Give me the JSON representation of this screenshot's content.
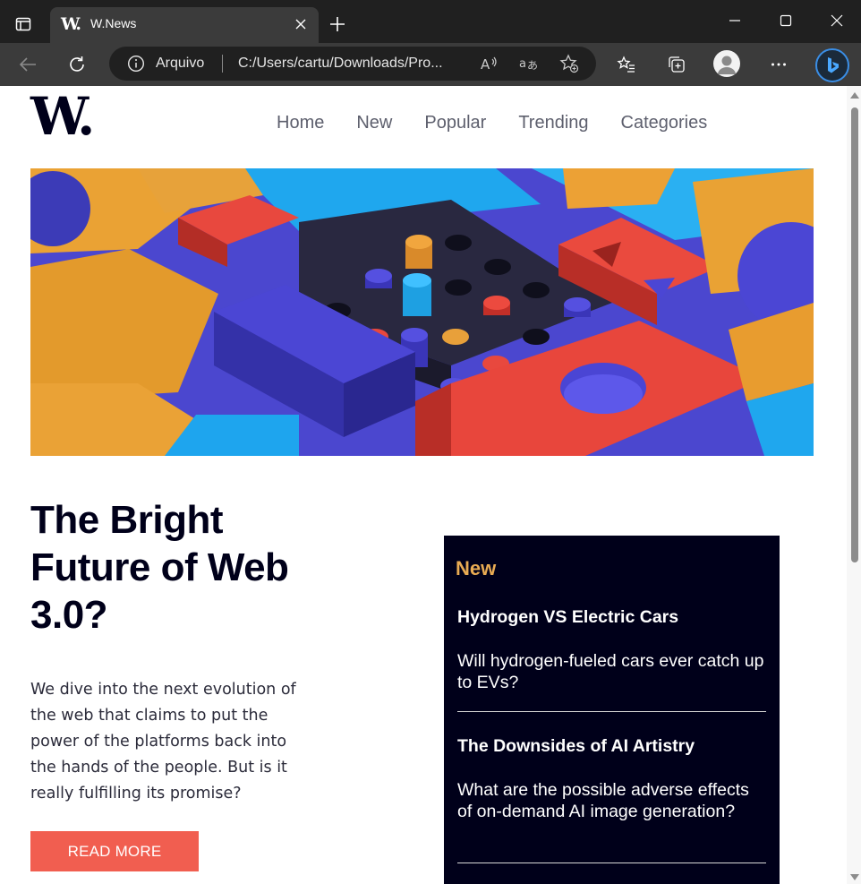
{
  "browser": {
    "tab_title": "W.News",
    "tab_favicon": "W.",
    "address_label": "Arquivo",
    "address_url": "C:/Users/cartu/Downloads/Pro...",
    "icons": [
      "tab-actions-icon",
      "close-icon",
      "plus-icon",
      "minimize-icon",
      "maximize-icon",
      "close-window-icon",
      "back-arrow-icon",
      "refresh-icon",
      "info-icon",
      "read-aloud-icon",
      "translate-icon",
      "add-favorite-icon",
      "favorites-icon",
      "collections-icon",
      "profile-icon",
      "more-icon",
      "bing-icon"
    ]
  },
  "site": {
    "logo": "W.",
    "nav": [
      "Home",
      "New",
      "Popular",
      "Trending",
      "Categories"
    ]
  },
  "article": {
    "headline": "The Bright Future of Web 3.0?",
    "lede": "We dive into the next evolution of the web that claims to put the power of the platforms back into the hands of the people. But is it really fulfilling its promise?",
    "cta": "READ MORE"
  },
  "sidebar": {
    "heading": "New",
    "items": [
      {
        "title": "Hydrogen VS Electric Cars",
        "desc": "Will hydrogen-fueled cars ever catch up to EVs?"
      },
      {
        "title": "The Downsides of AI Artistry",
        "desc": "What are the possible adverse effects of on-demand AI image generation?"
      }
    ]
  },
  "colors": {
    "navy": "#00001a",
    "accent_orange": "#e9ab53",
    "button_red": "#f15e50",
    "nav_gray": "#5d5f6d"
  }
}
